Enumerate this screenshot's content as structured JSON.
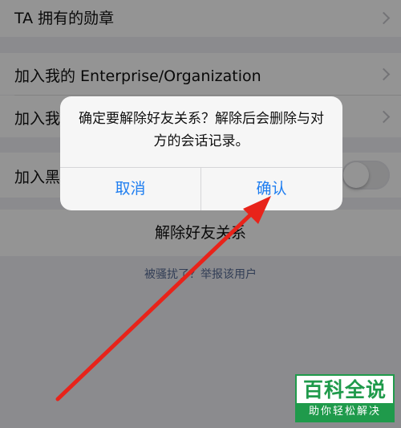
{
  "settings": {
    "badges_label": "TA 拥有的勋章",
    "enterprise_label": "加入我的 Enterprise/Organization",
    "join_my_label": "加入我",
    "blacklist_label": "加入黑",
    "delete_friend_label": "解除好友关系",
    "report_label": "被骚扰了？举报该用户"
  },
  "alert": {
    "message": "确定要解除好友关系？解除后会删除与对方的会话记录。",
    "cancel_label": "取消",
    "confirm_label": "确认"
  },
  "watermark": {
    "title": "百科全说",
    "subtitle": "助你轻松解决"
  },
  "colors": {
    "accent": "#1f7ef0",
    "arrow": "#e8231a",
    "watermark": "#1f9a4b",
    "link": "#576b95"
  }
}
